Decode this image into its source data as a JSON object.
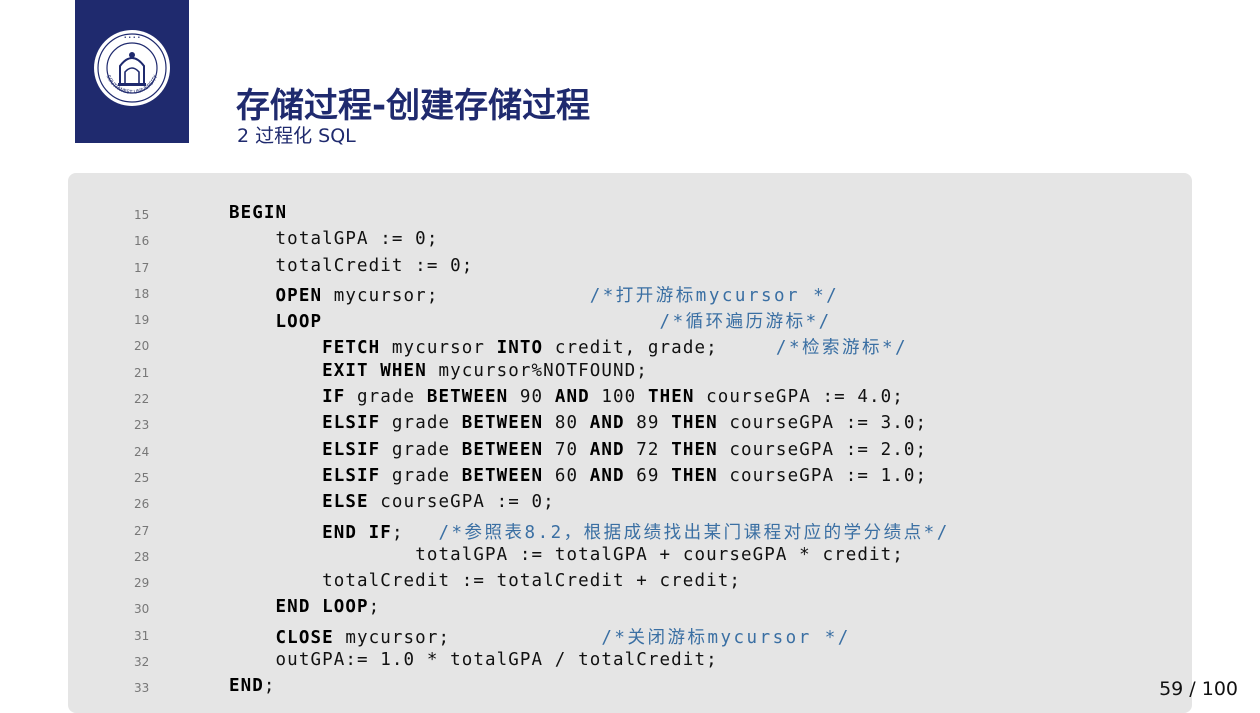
{
  "header": {
    "title": "存储过程-创建存储过程",
    "subtitle": "2 过程化 SQL"
  },
  "logo": {
    "icon": "university-seal-icon",
    "text": "SOUTHWEST UNIVERSITY",
    "bg_color": "#1f2a6e"
  },
  "code": {
    "lines": [
      {
        "no": "15",
        "indent": 0,
        "segs": [
          {
            "t": "BEGIN",
            "k": "kw"
          }
        ]
      },
      {
        "no": "16",
        "indent": 4,
        "segs": [
          {
            "t": "totalGPA := 0;"
          }
        ]
      },
      {
        "no": "17",
        "indent": 4,
        "segs": [
          {
            "t": "totalCredit := 0;"
          }
        ]
      },
      {
        "no": "18",
        "indent": 4,
        "segs": [
          {
            "t": "OPEN",
            "k": "kw"
          },
          {
            "t": " mycursor;             "
          },
          {
            "t": "/*打开游标mycursor */",
            "k": "cm"
          }
        ]
      },
      {
        "no": "19",
        "indent": 4,
        "segs": [
          {
            "t": "LOOP",
            "k": "kw"
          },
          {
            "t": "                             "
          },
          {
            "t": "/*循环遍历游标*/",
            "k": "cm"
          }
        ]
      },
      {
        "no": "20",
        "indent": 8,
        "segs": [
          {
            "t": "FETCH",
            "k": "kw"
          },
          {
            "t": " mycursor "
          },
          {
            "t": "INTO",
            "k": "kw"
          },
          {
            "t": " credit, grade;     "
          },
          {
            "t": "/*检索游标*/",
            "k": "cm"
          }
        ]
      },
      {
        "no": "21",
        "indent": 8,
        "segs": [
          {
            "t": "EXIT",
            "k": "kw"
          },
          {
            "t": " "
          },
          {
            "t": "WHEN",
            "k": "kw"
          },
          {
            "t": " mycursor%NOTFOUND;"
          }
        ]
      },
      {
        "no": "22",
        "indent": 8,
        "segs": [
          {
            "t": "IF",
            "k": "kw"
          },
          {
            "t": " grade "
          },
          {
            "t": "BETWEEN",
            "k": "kw"
          },
          {
            "t": " 90 "
          },
          {
            "t": "AND",
            "k": "kw"
          },
          {
            "t": " 100 "
          },
          {
            "t": "THEN",
            "k": "kw"
          },
          {
            "t": " courseGPA := 4.0;"
          }
        ]
      },
      {
        "no": "23",
        "indent": 8,
        "segs": [
          {
            "t": "ELSIF",
            "k": "kw"
          },
          {
            "t": " grade "
          },
          {
            "t": "BETWEEN",
            "k": "kw"
          },
          {
            "t": " 80 "
          },
          {
            "t": "AND",
            "k": "kw"
          },
          {
            "t": " 89 "
          },
          {
            "t": "THEN",
            "k": "kw"
          },
          {
            "t": " courseGPA := 3.0;"
          }
        ]
      },
      {
        "no": "24",
        "indent": 8,
        "segs": [
          {
            "t": "ELSIF",
            "k": "kw"
          },
          {
            "t": " grade "
          },
          {
            "t": "BETWEEN",
            "k": "kw"
          },
          {
            "t": " 70 "
          },
          {
            "t": "AND",
            "k": "kw"
          },
          {
            "t": " 72 "
          },
          {
            "t": "THEN",
            "k": "kw"
          },
          {
            "t": " courseGPA := 2.0;"
          }
        ]
      },
      {
        "no": "25",
        "indent": 8,
        "segs": [
          {
            "t": "ELSIF",
            "k": "kw"
          },
          {
            "t": " grade "
          },
          {
            "t": "BETWEEN",
            "k": "kw"
          },
          {
            "t": " 60 "
          },
          {
            "t": "AND",
            "k": "kw"
          },
          {
            "t": " 69 "
          },
          {
            "t": "THEN",
            "k": "kw"
          },
          {
            "t": " courseGPA := 1.0;"
          }
        ]
      },
      {
        "no": "26",
        "indent": 8,
        "segs": [
          {
            "t": "ELSE",
            "k": "kw"
          },
          {
            "t": " courseGPA := 0;"
          }
        ]
      },
      {
        "no": "27",
        "indent": 8,
        "segs": [
          {
            "t": "END",
            "k": "kw"
          },
          {
            "t": " "
          },
          {
            "t": "IF",
            "k": "kw"
          },
          {
            "t": ";   "
          },
          {
            "t": "/*参照表8.2，根据成绩找出某门课程对应的学分绩点*/",
            "k": "cm"
          }
        ]
      },
      {
        "no": "28",
        "indent": 16,
        "segs": [
          {
            "t": "totalGPA := totalGPA + courseGPA * credit;"
          }
        ]
      },
      {
        "no": "29",
        "indent": 8,
        "segs": [
          {
            "t": "totalCredit := totalCredit + credit;"
          }
        ]
      },
      {
        "no": "30",
        "indent": 4,
        "segs": [
          {
            "t": "END",
            "k": "kw"
          },
          {
            "t": " "
          },
          {
            "t": "LOOP",
            "k": "kw"
          },
          {
            "t": ";"
          }
        ]
      },
      {
        "no": "31",
        "indent": 4,
        "segs": [
          {
            "t": "CLOSE",
            "k": "kw"
          },
          {
            "t": " mycursor;             "
          },
          {
            "t": "/*关闭游标mycursor */",
            "k": "cm"
          }
        ]
      },
      {
        "no": "32",
        "indent": 4,
        "segs": [
          {
            "t": "outGPA:= 1.0 * totalGPA / totalCredit;"
          }
        ]
      },
      {
        "no": "33",
        "indent": 0,
        "segs": [
          {
            "t": "END",
            "k": "kw"
          },
          {
            "t": ";"
          }
        ]
      }
    ]
  },
  "footer": {
    "page_current": "59",
    "page_total": "100"
  }
}
